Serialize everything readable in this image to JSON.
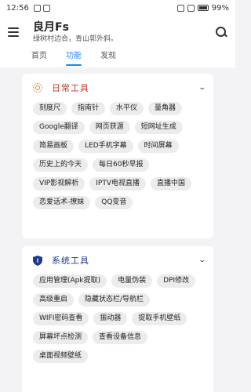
{
  "status": {
    "time": "12:56",
    "battery": "99%"
  },
  "header": {
    "title": "良月Fs",
    "subtitle": "绿树村边合，青山郭外斜。"
  },
  "tabs": [
    {
      "label": "首页",
      "active": false
    },
    {
      "label": "功能",
      "active": true
    },
    {
      "label": "发现",
      "active": false
    }
  ],
  "sections": [
    {
      "title": "日常工具",
      "icon": "sun-icon",
      "color": "#c0392b",
      "items": [
        "刻度尺",
        "指南针",
        "水平仪",
        "量角器",
        "Google翻译",
        "网页获源",
        "短网址生成",
        "简易画板",
        "LED手机字幕",
        "时间屏幕",
        "历史上的今天",
        "每日60秒早报",
        "VIP影视解析",
        "IPTV电视直播",
        "直播中国",
        "恋爱话术-撩妹",
        "QQ变音"
      ]
    },
    {
      "title": "系统工具",
      "icon": "shield-icon",
      "color": "#1e3a8a",
      "items": [
        "应用管理(Apk提取)",
        "电量伪装",
        "DPI修改",
        "高级重启",
        "隐藏状态栏/导航栏",
        "WIFI密码查看",
        "振动器",
        "提取手机壁纸",
        "屏幕坏点检测",
        "查看设备信息",
        "桌面视频壁纸"
      ]
    }
  ]
}
